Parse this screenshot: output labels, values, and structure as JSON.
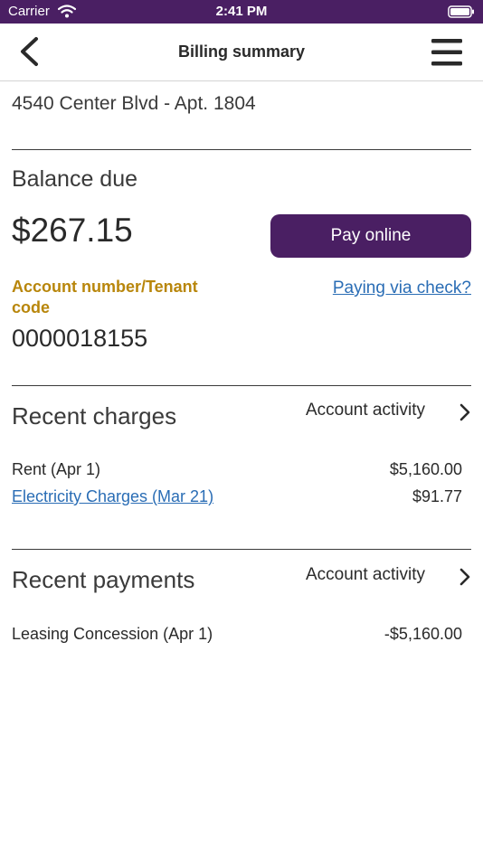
{
  "status_bar": {
    "carrier": "Carrier",
    "time": "2:41 PM"
  },
  "nav": {
    "title": "Billing summary"
  },
  "address": "4540 Center Blvd - Apt. 1804",
  "balance": {
    "label": "Balance due",
    "amount": "$267.15",
    "pay_button": "Pay online",
    "account_label": "Account number/Tenant code",
    "check_link": "Paying via check?",
    "account_number": "0000018155"
  },
  "recent_charges": {
    "title": "Recent charges",
    "activity_link": "Account activity",
    "items": [
      {
        "label": "Rent (Apr 1)",
        "amount": "$5,160.00"
      },
      {
        "label": "Electricity Charges (Mar 21)",
        "amount": "$91.77"
      }
    ]
  },
  "recent_payments": {
    "title": "Recent payments",
    "activity_link": "Account activity",
    "items": [
      {
        "label": "Leasing Concession (Apr 1)",
        "amount": "-$5,160.00"
      }
    ]
  },
  "colors": {
    "brand": "#4a1f63",
    "accent_gold": "#b8860b",
    "link": "#2a6db5"
  }
}
